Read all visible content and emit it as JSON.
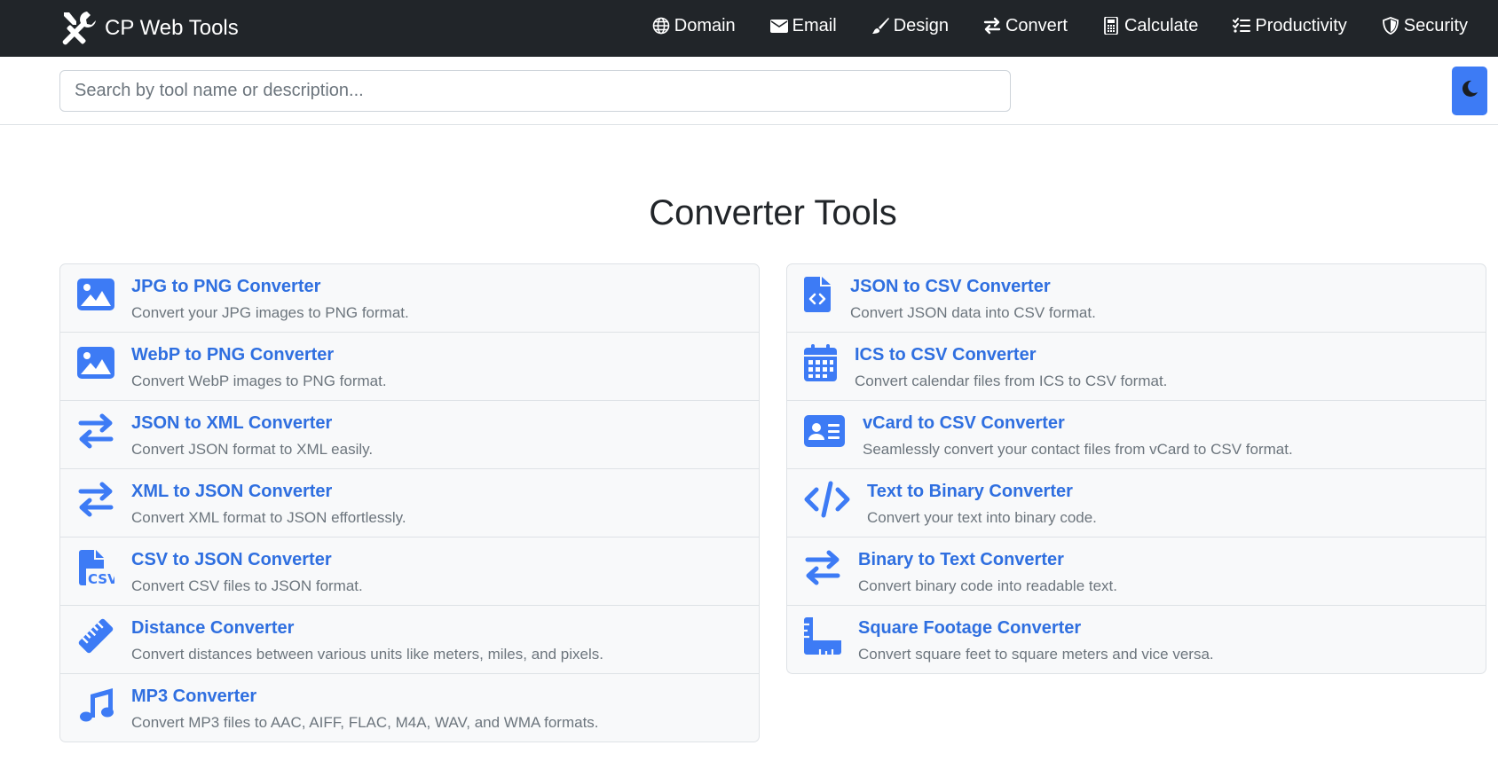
{
  "brand": {
    "title": "CP Web Tools",
    "icon": "tools-icon"
  },
  "nav": [
    {
      "label": "Domain",
      "icon": "globe-icon"
    },
    {
      "label": "Email",
      "icon": "envelope-icon"
    },
    {
      "label": "Design",
      "icon": "brush-icon"
    },
    {
      "label": "Convert",
      "icon": "arrows-exchange-icon"
    },
    {
      "label": "Calculate",
      "icon": "calculator-icon"
    },
    {
      "label": "Productivity",
      "icon": "checklist-icon"
    },
    {
      "label": "Security",
      "icon": "shield-icon"
    }
  ],
  "search": {
    "placeholder": "Search by tool name or description...",
    "value": ""
  },
  "theme_toggle": {
    "icon": "moon-icon"
  },
  "page": {
    "title": "Converter Tools"
  },
  "tools_left": [
    {
      "title": "JPG to PNG Converter",
      "description": "Convert your JPG images to PNG format.",
      "icon": "image-icon"
    },
    {
      "title": "WebP to PNG Converter",
      "description": "Convert WebP images to PNG format.",
      "icon": "image-icon"
    },
    {
      "title": "JSON to XML Converter",
      "description": "Convert JSON format to XML easily.",
      "icon": "arrows-exchange-icon"
    },
    {
      "title": "XML to JSON Converter",
      "description": "Convert XML format to JSON effortlessly.",
      "icon": "arrows-exchange-icon"
    },
    {
      "title": "CSV to JSON Converter",
      "description": "Convert CSV files to JSON format.",
      "icon": "file-csv-icon"
    },
    {
      "title": "Distance Converter",
      "description": "Convert distances between various units like meters, miles, and pixels.",
      "icon": "ruler-icon"
    },
    {
      "title": "MP3 Converter",
      "description": "Convert MP3 files to AAC, AIFF, FLAC, M4A, WAV, and WMA formats.",
      "icon": "music-icon"
    }
  ],
  "tools_right": [
    {
      "title": "JSON to CSV Converter",
      "description": "Convert JSON data into CSV format.",
      "icon": "file-code-icon"
    },
    {
      "title": "ICS to CSV Converter",
      "description": "Convert calendar files from ICS to CSV format.",
      "icon": "calendar-icon"
    },
    {
      "title": "vCard to CSV Converter",
      "description": "Seamlessly convert your contact files from vCard to CSV format.",
      "icon": "address-card-icon"
    },
    {
      "title": "Text to Binary Converter",
      "description": "Convert your text into binary code.",
      "icon": "code-icon"
    },
    {
      "title": "Binary to Text Converter",
      "description": "Convert binary code into readable text.",
      "icon": "arrows-exchange-icon"
    },
    {
      "title": "Square Footage Converter",
      "description": "Convert square feet to square meters and vice versa.",
      "icon": "ruler-combined-icon"
    }
  ],
  "colors": {
    "navbar": "#212529",
    "accent": "#2f6fe0",
    "icon": "#3d7bf5",
    "muted": "#6c757d",
    "list_bg": "#f8f9fa"
  }
}
